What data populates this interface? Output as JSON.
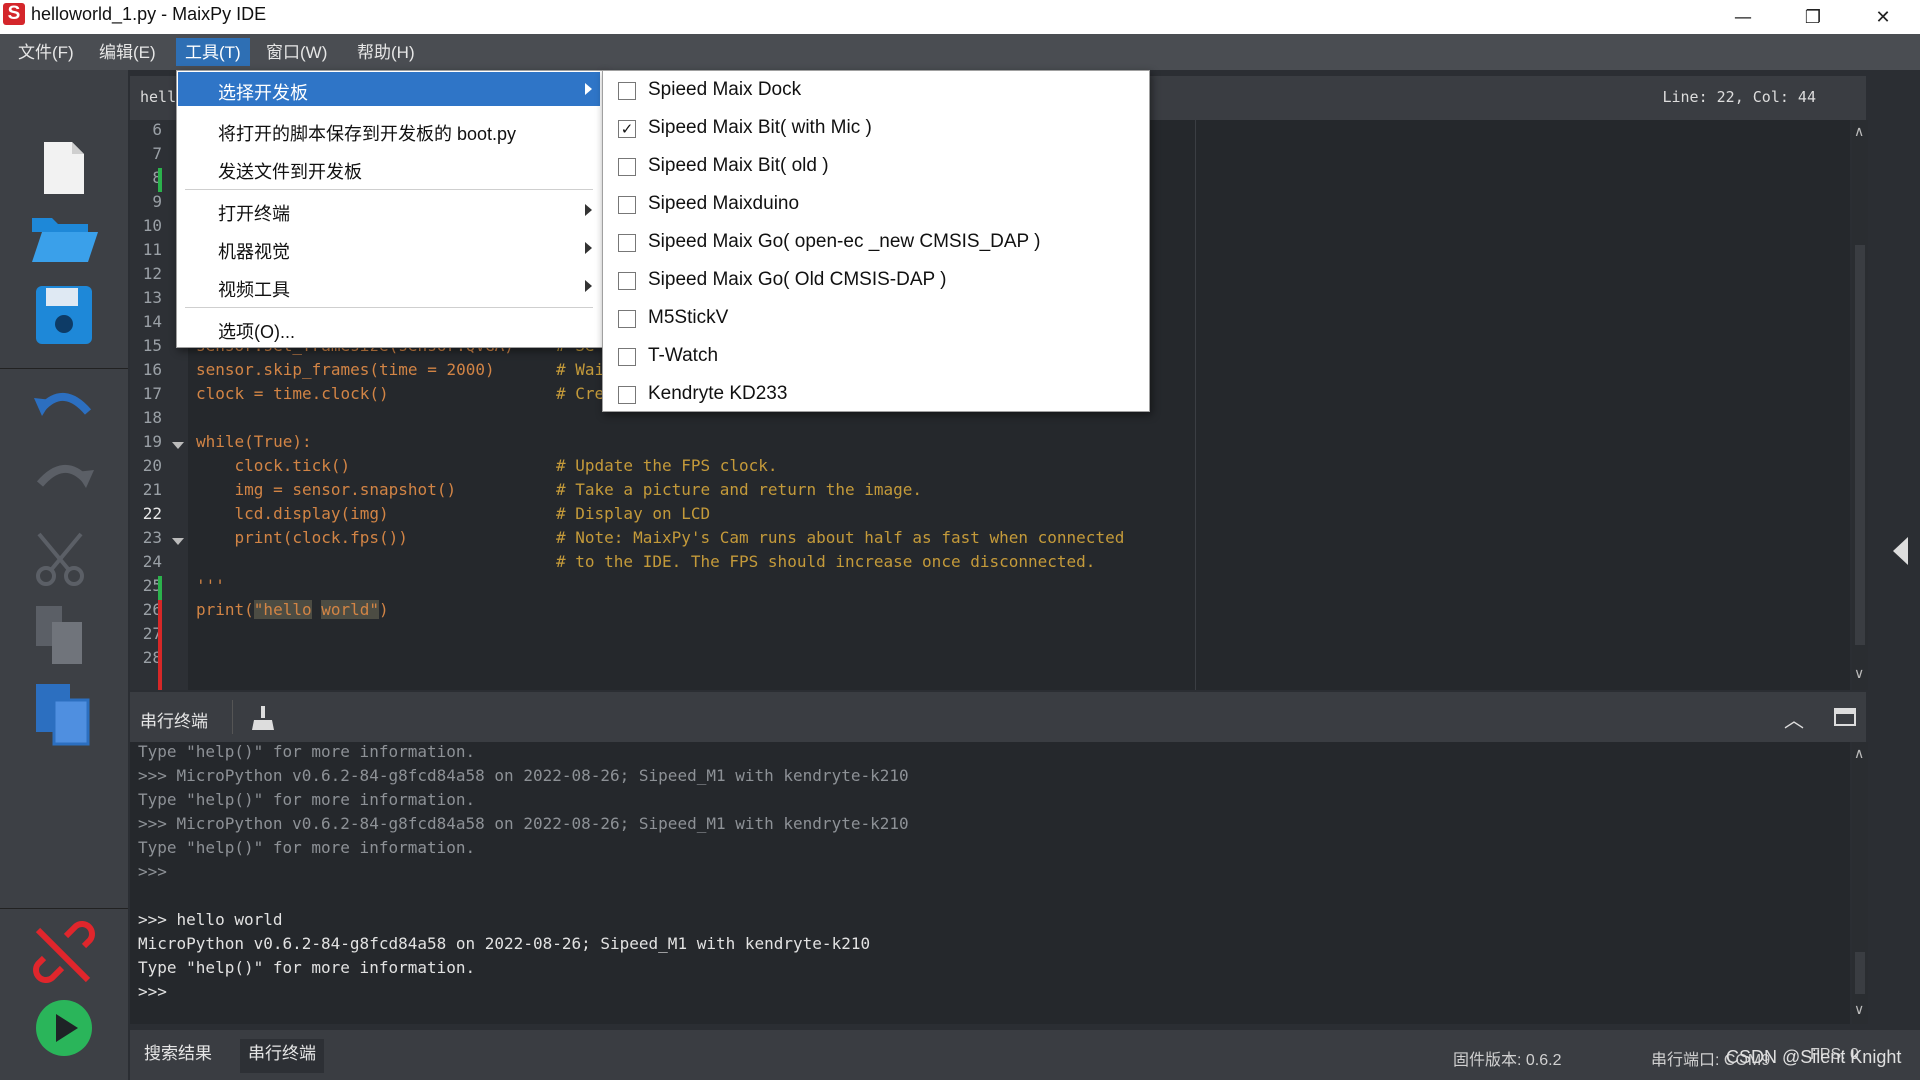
{
  "window": {
    "title": "helloworld_1.py - MaixPy IDE",
    "app_icon_letter": "S",
    "minimize": "—",
    "restore": "❐",
    "close": "✕"
  },
  "menubar": [
    {
      "label": "文件(F)"
    },
    {
      "label": "编辑(E)"
    },
    {
      "label": "工具(T)",
      "active": true
    },
    {
      "label": "窗口(W)"
    },
    {
      "label": "帮助(H)"
    }
  ],
  "tools_menu": {
    "items": [
      {
        "label": "选择开发板",
        "submenu": true,
        "highlighted": true
      },
      {
        "label": "将打开的脚本保存到开发板的 boot.py"
      },
      {
        "label": "发送文件到开发板"
      },
      {
        "label": "打开终端",
        "submenu": true
      },
      {
        "label": "机器视觉",
        "submenu": true
      },
      {
        "label": "视频工具",
        "submenu": true
      },
      {
        "label": "选项(O)..."
      }
    ]
  },
  "board_submenu": {
    "items": [
      {
        "label": "Spieed Maix Dock",
        "checked": false
      },
      {
        "label": "Sipeed Maix Bit( with Mic )",
        "checked": true
      },
      {
        "label": "Sipeed Maix Bit( old )",
        "checked": false
      },
      {
        "label": "Sipeed Maixduino",
        "checked": false
      },
      {
        "label": "Sipeed Maix Go( open-ec _new CMSIS_DAP )",
        "checked": false
      },
      {
        "label": "Sipeed Maix Go( Old CMSIS-DAP )",
        "checked": false
      },
      {
        "label": "M5StickV",
        "checked": false
      },
      {
        "label": "T-Watch",
        "checked": false
      },
      {
        "label": "Kendryte KD233",
        "checked": false
      }
    ],
    "check_glyph": "✓"
  },
  "editor": {
    "tab_partial": "hell",
    "cursor_position": "Line: 22, Col: 44",
    "line_numbers": [
      "6",
      "7",
      "8",
      "9",
      "10",
      "11",
      "12",
      "13",
      "14",
      "15",
      "16",
      "17",
      "18",
      "19",
      "20",
      "21",
      "22",
      "23",
      "24",
      "25",
      "26",
      "27",
      "28"
    ],
    "current_line": "22",
    "code": {
      "l15": "sensor.set_framesize(sensor.QVGA)",
      "l15c": "# Se",
      "l16": "sensor.skip_frames(time = 2000)",
      "l16c": "# Wai",
      "l17": "clock = time.clock()",
      "l17c": "# Cre",
      "l19": "while(True):",
      "l20": "    clock.tick()",
      "l20c": "# Update the FPS clock.",
      "l21": "    img = sensor.snapshot()",
      "l21c": "# Take a picture and return the image.",
      "l22": "    lcd.display(img)",
      "l22c": "# Display on LCD",
      "l23": "    print(clock.fps())",
      "l23c": "# Note: MaixPy's Cam runs about half as fast when connected",
      "l24c": "# to the IDE. The FPS should increase once disconnected.",
      "l25": "'''",
      "l26_print": "print(",
      "l26_s1": "\"hello",
      "l26_s2": "world\"",
      "l26_close": ")"
    },
    "scroll_up": "∧",
    "scroll_down": "∨"
  },
  "terminal": {
    "title": "串行终端",
    "lines": [
      {
        "text": "Type \"help()\" for more information.",
        "style": "dim"
      },
      {
        "text": ">>> MicroPython v0.6.2-84-g8fcd84a58 on 2022-08-26; Sipeed_M1 with kendryte-k210",
        "style": "dim"
      },
      {
        "text": "Type \"help()\" for more information.",
        "style": "dim"
      },
      {
        "text": ">>> MicroPython v0.6.2-84-g8fcd84a58 on 2022-08-26; Sipeed_M1 with kendryte-k210",
        "style": "dim"
      },
      {
        "text": "Type \"help()\" for more information.",
        "style": "dim"
      },
      {
        "text": ">>>",
        "style": "dim"
      },
      {
        "text": "",
        "style": "dim"
      },
      {
        "text": ">>> hello world",
        "style": "bright"
      },
      {
        "text": "MicroPython v0.6.2-84-g8fcd84a58 on 2022-08-26; Sipeed_M1 with kendryte-k210",
        "style": "bright"
      },
      {
        "text": "Type \"help()\" for more information.",
        "style": "bright"
      },
      {
        "text": ">>>",
        "style": "bright"
      }
    ]
  },
  "statusbar": {
    "tab_search": "搜索结果",
    "tab_terminal": "串行终端",
    "firmware": "固件版本: 0.6.2",
    "serial_port": "串行端口: COM9",
    "fps": "FPS: 0",
    "watermark": "CSDN @Silent Knight"
  },
  "colors": {
    "accent": "#2f75c7",
    "modified_green": "#2bb24c",
    "unsaved_red": "#d62828",
    "disconnect_red": "#e0262c",
    "run_green": "#2ab55a"
  }
}
